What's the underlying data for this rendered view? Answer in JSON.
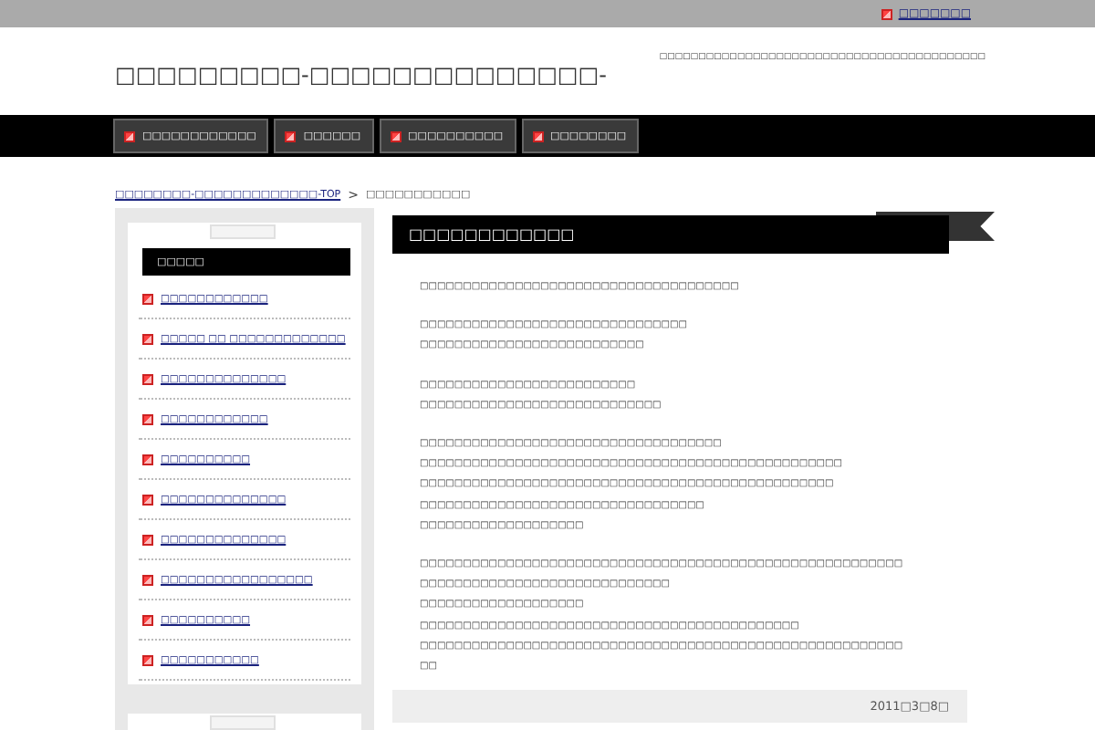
{
  "top_bar": {
    "link": "□□□□□□□"
  },
  "header": {
    "title": "□□□□□□□□□-□□□□□□□□□□□□□□-",
    "tagline": "□□□□□□□□□□□□□□□□□□□□□□□□□□□□□□□□□□□□□□□□□□"
  },
  "nav": [
    {
      "label": "□□□□□□□□□□□□"
    },
    {
      "label": "□□□□□□"
    },
    {
      "label": "□□□□□□□□□□"
    },
    {
      "label": "□□□□□□□□"
    }
  ],
  "breadcrumb": {
    "home": "□□□□□□□□-□□□□□□□□□□□□□-TOP",
    "separator": ">",
    "current": "□□□□□□□□□□□"
  },
  "sidebar": {
    "heading": "□□□□□",
    "items": [
      "□□□□□□□□□□□□",
      "□□□□□ □□ □□□□□□□□□□□□□",
      "□□□□□□□□□□□□□□",
      "□□□□□□□□□□□□",
      "□□□□□□□□□□",
      "□□□□□□□□□□□□□□",
      "□□□□□□□□□□□□□□",
      "□□□□□□□□□□□□□□□□□",
      "□□□□□□□□□□",
      "□□□□□□□□□□□"
    ]
  },
  "article": {
    "title": "□□□□□□□□□□□□",
    "paragraphs": [
      [
        "□□□□□□□□□□□□□□□□□□□□□□□□□□□□□□□□□□□□□"
      ],
      [
        "□□□□□□□□□□□□□□□□□□□□□□□□□□□□□□□",
        "□□□□□□□□□□□□□□□□□□□□□□□□□□"
      ],
      [
        "□□□□□□□□□□□□□□□□□□□□□□□□□",
        "□□□□□□□□□□□□□□□□□□□□□□□□□□□□"
      ],
      [
        "□□□□□□□□□□□□□□□□□□□□□□□□□□□□□□□□□□□",
        "□□□□□□□□□□□□□□□□□□□□□□□□□□□□□□□□□□□□□□□□□□□□□□□□□",
        "□□□□□□□□□□□□□□□□□□□□□□□□□□□□□□□□□□□□□□□□□□□□□□□□",
        "□□□□□□□□□□□□□□□□□□□□□□□□□□□□□□□□□",
        "□□□□□□□□□□□□□□□□□□□"
      ],
      [
        "□□□□□□□□□□□□□□□□□□□□□□□□□□□□□□□□□□□□□□□□□□□□□□□□□□□□□□□□",
        "□□□□□□□□□□□□□□□□□□□□□□□□□□□□□",
        "□□□□□□□□□□□□□□□□□□□",
        "□□□□□□□□□□□□□□□□□□□□□□□□□□□□□□□□□□□□□□□□□□□□",
        "□□□□□□□□□□□□□□□□□□□□□□□□□□□□□□□□□□□□□□□□□□□□□□□□□□□□□□□□",
        "□□"
      ]
    ],
    "date": "2011□3□8□"
  }
}
